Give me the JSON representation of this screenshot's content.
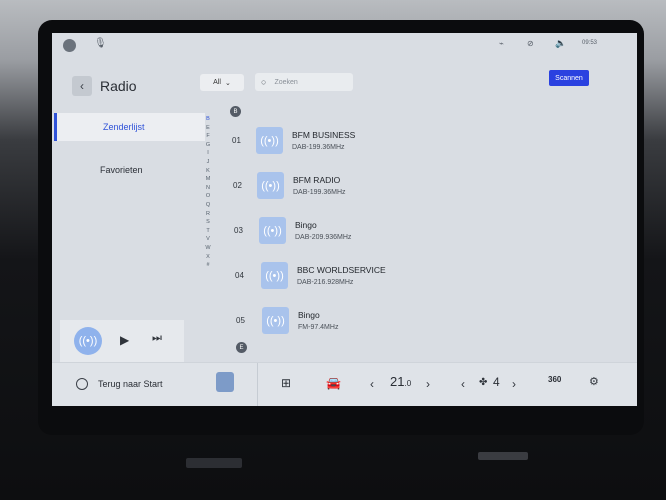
{
  "header": {
    "title": "Radio",
    "back_icon": "chevron-left-icon",
    "time": "09:53"
  },
  "sidebar": {
    "items": [
      {
        "label": "Zenderlijst",
        "selected": true
      },
      {
        "label": "Favorieten",
        "selected": false
      }
    ]
  },
  "toolbar": {
    "filter_label": "All",
    "search_placeholder": "Zoeken",
    "scan_label": "Scannen"
  },
  "alphabet": [
    "B",
    "E",
    "F",
    "G",
    "I",
    "J",
    "K",
    "M",
    "N",
    "O",
    "Q",
    "R",
    "S",
    "T",
    "V",
    "W",
    "X",
    "#"
  ],
  "groups": {
    "first": "B",
    "next": "E"
  },
  "stations": [
    {
      "num": "01",
      "name": "BFM BUSINESS",
      "freq": "DAB-199.36MHz"
    },
    {
      "num": "02",
      "name": "BFM RADIO",
      "freq": "DAB-199.36MHz"
    },
    {
      "num": "03",
      "name": "Bingo",
      "freq": "DAB-209.936MHz"
    },
    {
      "num": "04",
      "name": "BBC WORLDSERVICE",
      "freq": "DAB-216.928MHz"
    },
    {
      "num": "05",
      "name": "Bingo",
      "freq": "FM-97.4MHz"
    }
  ],
  "bottom": {
    "return_label": "Terug naar Start",
    "temperature": "21",
    "temperature_decimal": ".0",
    "fan_level": "4",
    "view_label": "360"
  },
  "colors": {
    "accent": "#2f52d8",
    "scan_button": "#2a41e0",
    "station_icon": "#a9c3ec"
  }
}
